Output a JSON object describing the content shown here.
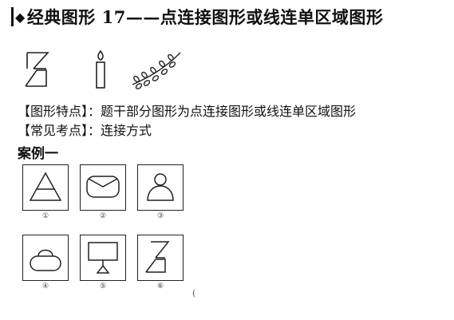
{
  "header": {
    "title": "经典图形 17——点连接图形或线连单区域图形"
  },
  "info": {
    "feature_label": "【图形特点】：",
    "feature_text": "题干部分图形为点连接图形或线连单区域图形",
    "exam_label": "【常见考点】：",
    "exam_text": "连接方式"
  },
  "case": {
    "title": "案例一",
    "options": [
      "①",
      "②",
      "③",
      "④",
      "⑤",
      "⑥"
    ]
  },
  "stray_mark": "("
}
